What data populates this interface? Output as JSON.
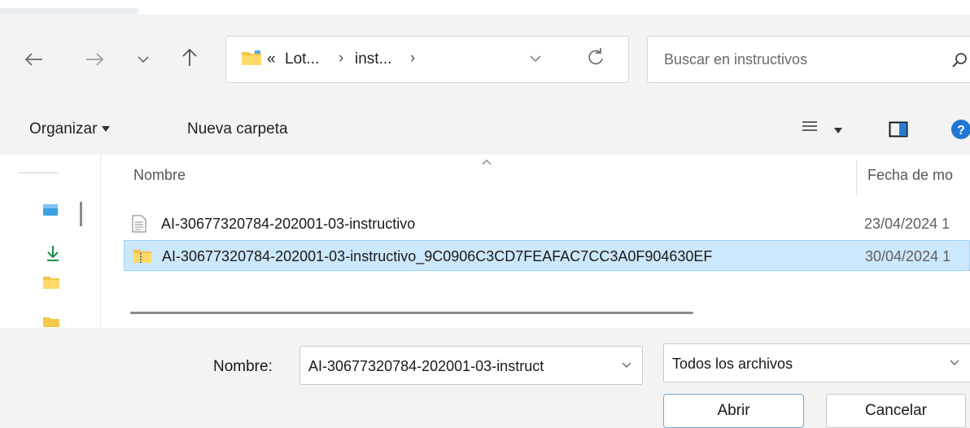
{
  "nav": {
    "back_icon": "arrow-left-icon",
    "forward_icon": "arrow-right-icon",
    "recent_icon": "chevron-down-icon",
    "up_icon": "arrow-up-icon"
  },
  "address": {
    "overflow": "«",
    "crumbs": [
      "Lot...",
      "inst..."
    ],
    "separator": "›",
    "refresh_icon": "refresh-icon"
  },
  "search": {
    "placeholder": "Buscar en instructivos"
  },
  "commandbar": {
    "organize": "Organizar",
    "new_folder": "Nueva carpeta",
    "help": "?"
  },
  "list": {
    "columns": [
      "Nombre",
      "Fecha de mo"
    ],
    "rows": [
      {
        "name": "AI-30677320784-202001-03-instructivo",
        "date": "23/04/2024 1",
        "icon": "text-file-icon",
        "selected": false
      },
      {
        "name": "AI-30677320784-202001-03-instructivo_9C0906C3CD7FEAFAC7CC3A0F904630EF",
        "date": "30/04/2024 1",
        "icon": "zip-folder-icon",
        "selected": true
      }
    ]
  },
  "footer": {
    "name_label": "Nombre:",
    "name_value": "AI-30677320784-202001-03-instruct",
    "filter_value": "Todos los archivos",
    "open": "Abrir",
    "cancel": "Cancelar"
  },
  "colors": {
    "selection": "#cce8ff",
    "selection_border": "#99d1ff",
    "accent": "#0067c0"
  }
}
